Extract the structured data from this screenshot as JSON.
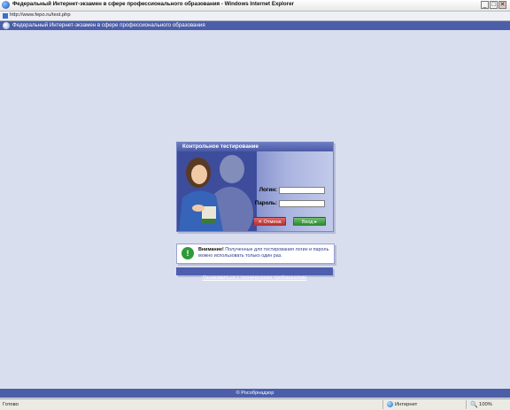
{
  "window": {
    "title": "Федеральный Интернет-экзамен в сфере профессионального образования - Windows Internet Explorer",
    "minimize": "_",
    "maximize": "□",
    "close": "✕"
  },
  "address": {
    "url": "http://www.fepo.ru/test.php"
  },
  "header": {
    "title": "Федеральный Интернет-экзамен в сфере профессионального образования"
  },
  "login": {
    "title": "Контрольное тестирование",
    "login_label": "Логин:",
    "password_label": "Пароль:",
    "login_value": "",
    "password_value": "",
    "cancel_label": "✕ Отмена",
    "enter_label": "Вход ▸"
  },
  "notice": {
    "icon": "!",
    "title": "Внимание!",
    "text": "Полученные для тестирования логин и пароль можно использовать только один раз."
  },
  "requirements": {
    "link": "Ознакомиться с техническими требованиями"
  },
  "footer": {
    "text": "© Рособрнадзор"
  },
  "status": {
    "left": "Готово",
    "zone": "Интернет",
    "zoom": "100%"
  },
  "colors": {
    "page_background": "#d9deef",
    "header_bar": "#4c5ea8",
    "notice_text": "#2c3e8f",
    "cancel_button": "#c43a3a",
    "enter_button": "#3c9a3c"
  },
  "icons": [
    "ie-icon",
    "page-icon",
    "site-logo-icon",
    "warning-icon",
    "internet-zone-icon",
    "zoom-icon"
  ]
}
